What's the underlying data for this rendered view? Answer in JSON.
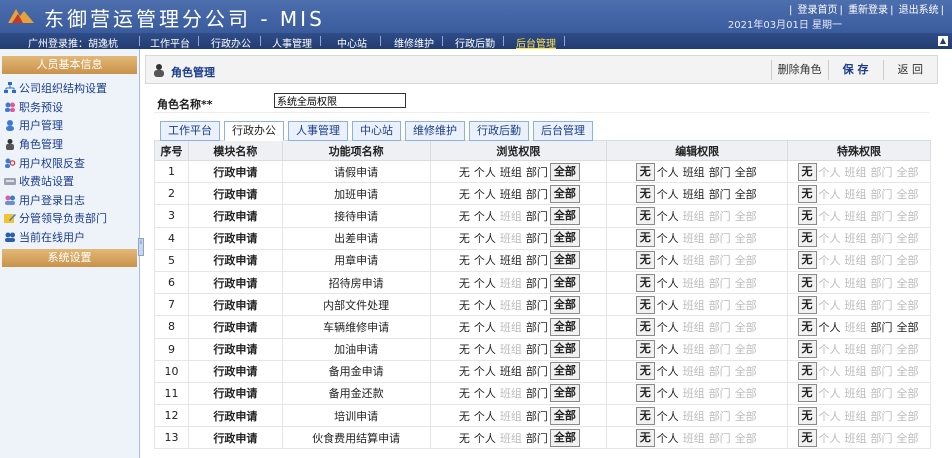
{
  "header": {
    "title": "东御营运管理分公司 - MIS",
    "links": [
      "登录首页",
      "重新登录",
      "退出系统"
    ],
    "date": "2021年03月01日 星期一"
  },
  "menubar": {
    "user": "广州登录推：胡逸杭",
    "items": [
      "工作平台",
      "行政办公",
      "人事管理",
      "中心站",
      "维修维护",
      "行政后勤",
      "后台管理"
    ],
    "active_index": 6
  },
  "sidebar": {
    "section1": "人员基本信息",
    "items": [
      {
        "label": "公司组织结构设置",
        "icon": "org-chart-icon"
      },
      {
        "label": "职务预设",
        "icon": "users-icon"
      },
      {
        "label": "用户管理",
        "icon": "user-icon"
      },
      {
        "label": "角色管理",
        "icon": "role-icon"
      },
      {
        "label": "用户权限反查",
        "icon": "user-search-icon"
      },
      {
        "label": "收费站设置",
        "icon": "toll-station-icon"
      },
      {
        "label": "用户登录日志",
        "icon": "login-log-icon"
      },
      {
        "label": "分管领导负责部门",
        "icon": "leader-icon"
      },
      {
        "label": "当前在线用户",
        "icon": "online-users-icon"
      }
    ],
    "section2": "系统设置"
  },
  "page": {
    "title": "角色管理",
    "buttons": {
      "delete": "删除角色",
      "save": "保 存",
      "back": "返 回"
    },
    "role_name_label": "角色名称**",
    "role_name_value": "系统全局权限"
  },
  "tabs": [
    "工作平台",
    "行政办公",
    "人事管理",
    "中心站",
    "维修维护",
    "行政后勤",
    "后台管理"
  ],
  "active_tab": 1,
  "table": {
    "headers": [
      "序号",
      "模块名称",
      "功能项名称",
      "浏览权限",
      "编辑权限",
      "特殊权限"
    ],
    "perm_labels": [
      "无",
      "个人",
      "班组",
      "部门",
      "全部"
    ],
    "rows": [
      {
        "no": "1",
        "module": "行政申请",
        "func": "请假申请",
        "browse": [
          1,
          1,
          1,
          1,
          1
        ],
        "edit": [
          1,
          1,
          1,
          1,
          1
        ],
        "special": [
          1,
          0,
          0,
          0,
          0
        ],
        "browse_sel": 4,
        "edit_sel": 0,
        "special_sel": 0
      },
      {
        "no": "2",
        "module": "行政申请",
        "func": "加班申请",
        "browse": [
          1,
          1,
          1,
          1,
          1
        ],
        "edit": [
          1,
          1,
          1,
          1,
          1
        ],
        "special": [
          1,
          0,
          0,
          0,
          0
        ],
        "browse_sel": 4,
        "edit_sel": 0,
        "special_sel": 0
      },
      {
        "no": "3",
        "module": "行政申请",
        "func": "接待申请",
        "browse": [
          1,
          1,
          0,
          1,
          1
        ],
        "edit": [
          1,
          1,
          0,
          0,
          0
        ],
        "special": [
          1,
          0,
          0,
          0,
          0
        ],
        "browse_sel": 4,
        "edit_sel": 0,
        "special_sel": 0
      },
      {
        "no": "4",
        "module": "行政申请",
        "func": "出差申请",
        "browse": [
          1,
          1,
          0,
          1,
          1
        ],
        "edit": [
          1,
          1,
          0,
          0,
          0
        ],
        "special": [
          1,
          0,
          0,
          0,
          0
        ],
        "browse_sel": 4,
        "edit_sel": 0,
        "special_sel": 0
      },
      {
        "no": "5",
        "module": "行政申请",
        "func": "用章申请",
        "browse": [
          1,
          1,
          1,
          1,
          1
        ],
        "edit": [
          1,
          1,
          0,
          0,
          0
        ],
        "special": [
          1,
          0,
          0,
          0,
          0
        ],
        "browse_sel": 4,
        "edit_sel": 0,
        "special_sel": 0
      },
      {
        "no": "6",
        "module": "行政申请",
        "func": "招待房申请",
        "browse": [
          1,
          1,
          0,
          1,
          1
        ],
        "edit": [
          1,
          1,
          0,
          0,
          0
        ],
        "special": [
          1,
          0,
          0,
          0,
          0
        ],
        "browse_sel": 4,
        "edit_sel": 0,
        "special_sel": 0
      },
      {
        "no": "7",
        "module": "行政申请",
        "func": "内部文件处理",
        "browse": [
          1,
          1,
          0,
          1,
          1
        ],
        "edit": [
          1,
          1,
          0,
          0,
          0
        ],
        "special": [
          1,
          0,
          0,
          0,
          0
        ],
        "browse_sel": 4,
        "edit_sel": 0,
        "special_sel": 0
      },
      {
        "no": "8",
        "module": "行政申请",
        "func": "车辆维修申请",
        "browse": [
          1,
          1,
          0,
          1,
          1
        ],
        "edit": [
          1,
          1,
          0,
          0,
          0
        ],
        "special": [
          1,
          1,
          0,
          1,
          1
        ],
        "browse_sel": 4,
        "edit_sel": 0,
        "special_sel": 0
      },
      {
        "no": "9",
        "module": "行政申请",
        "func": "加油申请",
        "browse": [
          1,
          1,
          0,
          1,
          1
        ],
        "edit": [
          1,
          1,
          0,
          0,
          0
        ],
        "special": [
          1,
          0,
          0,
          0,
          0
        ],
        "browse_sel": 4,
        "edit_sel": 0,
        "special_sel": 0
      },
      {
        "no": "10",
        "module": "行政申请",
        "func": "备用金申请",
        "browse": [
          1,
          1,
          1,
          1,
          1
        ],
        "edit": [
          1,
          1,
          0,
          0,
          0
        ],
        "special": [
          1,
          0,
          0,
          0,
          0
        ],
        "browse_sel": 4,
        "edit_sel": 0,
        "special_sel": 0
      },
      {
        "no": "11",
        "module": "行政申请",
        "func": "备用金还款",
        "browse": [
          1,
          1,
          0,
          1,
          1
        ],
        "edit": [
          1,
          1,
          0,
          0,
          0
        ],
        "special": [
          1,
          0,
          0,
          0,
          0
        ],
        "browse_sel": 4,
        "edit_sel": 0,
        "special_sel": 0
      },
      {
        "no": "12",
        "module": "行政申请",
        "func": "培训申请",
        "browse": [
          1,
          1,
          0,
          1,
          1
        ],
        "edit": [
          1,
          1,
          0,
          0,
          0
        ],
        "special": [
          1,
          0,
          0,
          0,
          0
        ],
        "browse_sel": 4,
        "edit_sel": 0,
        "special_sel": 0
      },
      {
        "no": "13",
        "module": "行政申请",
        "func": "伙食费用结算申请",
        "browse": [
          1,
          1,
          0,
          1,
          1
        ],
        "edit": [
          1,
          1,
          0,
          0,
          0
        ],
        "special": [
          1,
          0,
          0,
          0,
          0
        ],
        "browse_sel": 4,
        "edit_sel": 0,
        "special_sel": 0
      }
    ]
  },
  "colors": {
    "header": "#3a5b9c",
    "menubar": "#233d72",
    "accent": "#1a3d8c",
    "sidebar_head": "#c9924a"
  }
}
